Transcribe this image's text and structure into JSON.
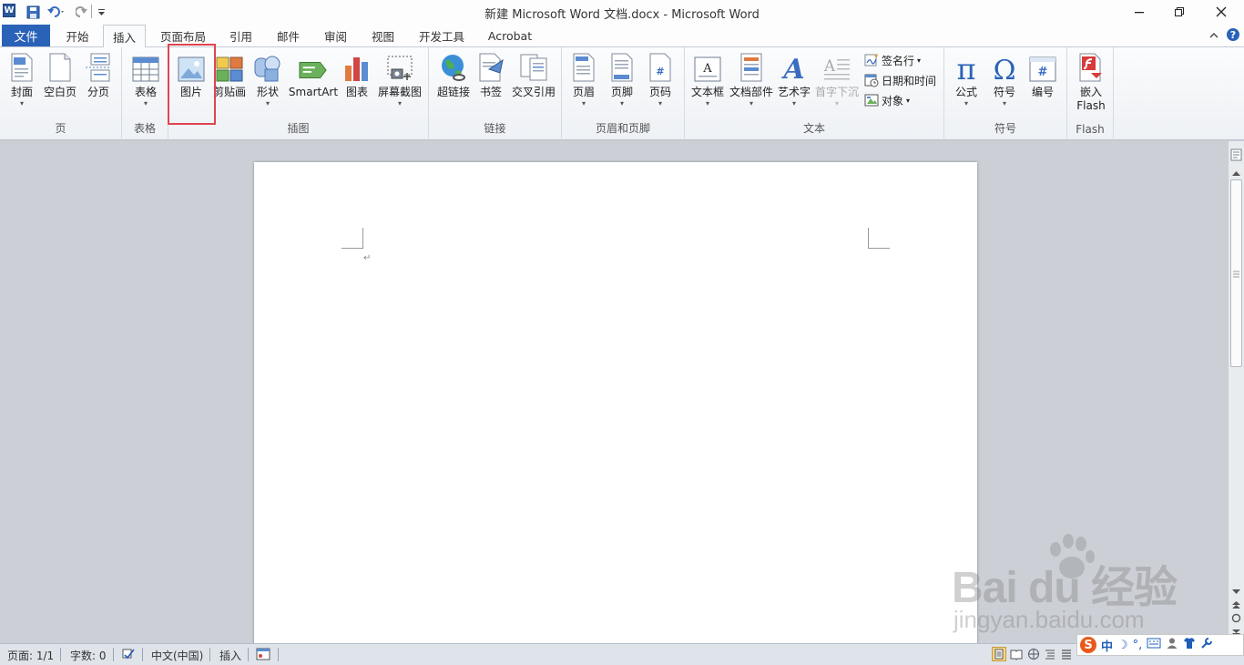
{
  "window": {
    "title": "新建 Microsoft Word 文档.docx - Microsoft Word",
    "app_icon_letter": "W"
  },
  "menu": {
    "file": "文件",
    "tabs": [
      "开始",
      "插入",
      "页面布局",
      "引用",
      "邮件",
      "审阅",
      "视图",
      "开发工具",
      "Acrobat"
    ],
    "active_tab": "插入"
  },
  "ribbon": {
    "groups": {
      "page": {
        "label": "页",
        "buttons": [
          "封面",
          "空白页",
          "分页"
        ]
      },
      "table": {
        "label": "表格",
        "buttons": [
          "表格"
        ]
      },
      "illustrations": {
        "label": "插图",
        "buttons": [
          "图片",
          "剪贴画",
          "形状",
          "SmartArt",
          "图表",
          "屏幕截图"
        ]
      },
      "links": {
        "label": "链接",
        "buttons": [
          "超链接",
          "书签",
          "交叉引用"
        ]
      },
      "header_footer": {
        "label": "页眉和页脚",
        "buttons": [
          "页眉",
          "页脚",
          "页码"
        ]
      },
      "text": {
        "label": "文本",
        "buttons": [
          "文本框",
          "文档部件",
          "艺术字",
          "首字下沉"
        ],
        "small": [
          "签名行",
          "日期和时间",
          "对象"
        ]
      },
      "symbols": {
        "label": "符号",
        "buttons": [
          "公式",
          "符号",
          "编号"
        ]
      },
      "flash": {
        "label": "Flash",
        "button_line1": "嵌入",
        "button_line2": "Flash"
      }
    }
  },
  "document": {
    "pilcrow": "↵"
  },
  "status": {
    "page": "页面: 1/1",
    "words": "字数: 0",
    "language": "中文(中国)",
    "mode": "插入"
  },
  "watermark": {
    "main": "Bai du 经验",
    "sub": "jingyan.baidu.com"
  },
  "ime": {
    "logo": "S",
    "lang": "中"
  },
  "colors": {
    "accent": "#2a62b8",
    "highlight": "#e0454f"
  }
}
